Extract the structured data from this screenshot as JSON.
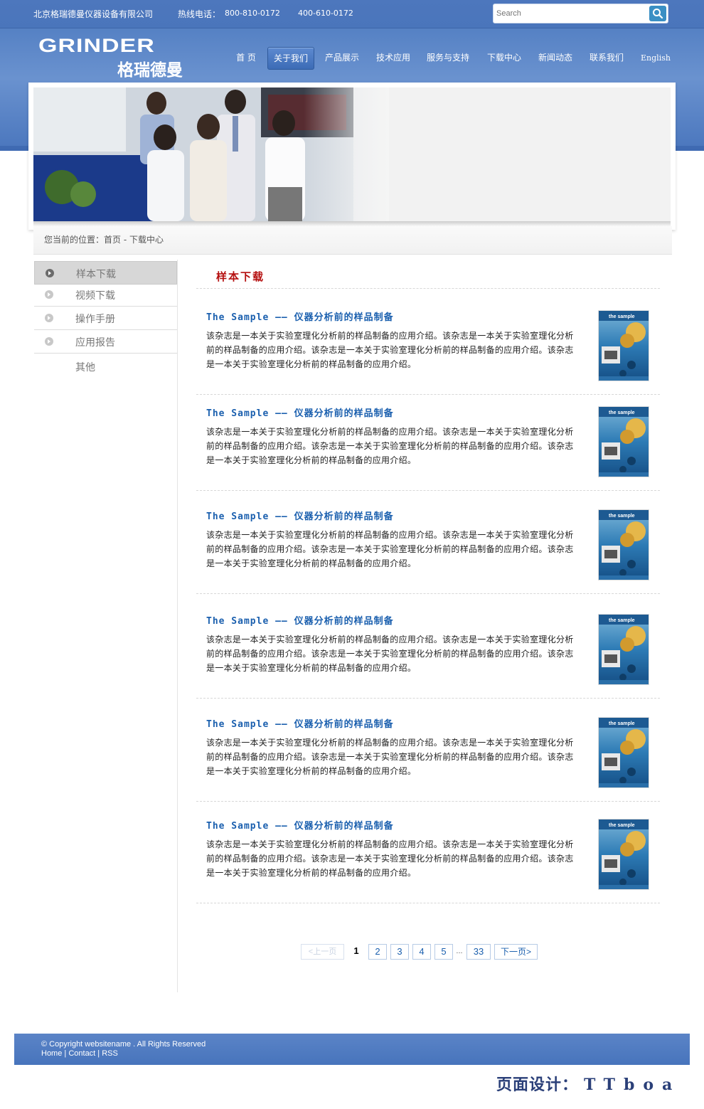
{
  "topbar": {
    "company": "北京格瑞德曼仪器设备有限公司",
    "hotline_label": "热线电话：",
    "phone1": "800-810-0172",
    "phone2": "400-610-0172"
  },
  "search": {
    "placeholder": "Search",
    "icon": "search-icon"
  },
  "logo": {
    "en": "GRINDER",
    "cn": "格瑞德曼"
  },
  "nav": {
    "items": [
      {
        "label": "首 页"
      },
      {
        "label": "关于我们",
        "active": true
      },
      {
        "label": "产品展示"
      },
      {
        "label": "技术应用"
      },
      {
        "label": "服务与支持"
      },
      {
        "label": "下载中心"
      },
      {
        "label": "新闻动态"
      },
      {
        "label": "联系我们"
      },
      {
        "label": "English"
      }
    ]
  },
  "breadcrumb": "您当前的位置：首页 - 下载中心",
  "sidebar": {
    "items": [
      {
        "label": "样本下载",
        "active": true
      },
      {
        "label": "视频下载"
      },
      {
        "label": "操作手册"
      },
      {
        "label": "应用报告"
      },
      {
        "label": "其他"
      }
    ]
  },
  "main": {
    "section_title": "样本下载",
    "items": [
      {
        "title": "The Sample —— 仪器分析前的样品制备",
        "desc": "该杂志是一本关于实验室理化分析前的样品制备的应用介绍。该杂志是一本关于实验室理化分析前的样品制备的应用介绍。该杂志是一本关于实验室理化分析前的样品制备的应用介绍。该杂志是一本关于实验室理化分析前的样品制备的应用介绍。",
        "thumb_text": "the sample"
      },
      {
        "title": "The Sample —— 仪器分析前的样品制备",
        "desc": "该杂志是一本关于实验室理化分析前的样品制备的应用介绍。该杂志是一本关于实验室理化分析前的样品制备的应用介绍。该杂志是一本关于实验室理化分析前的样品制备的应用介绍。该杂志是一本关于实验室理化分析前的样品制备的应用介绍。",
        "thumb_text": "the sample"
      },
      {
        "title": "The Sample —— 仪器分析前的样品制备",
        "desc": "该杂志是一本关于实验室理化分析前的样品制备的应用介绍。该杂志是一本关于实验室理化分析前的样品制备的应用介绍。该杂志是一本关于实验室理化分析前的样品制备的应用介绍。该杂志是一本关于实验室理化分析前的样品制备的应用介绍。",
        "thumb_text": "the sample"
      },
      {
        "title": "The Sample —— 仪器分析前的样品制备",
        "desc": "该杂志是一本关于实验室理化分析前的样品制备的应用介绍。该杂志是一本关于实验室理化分析前的样品制备的应用介绍。该杂志是一本关于实验室理化分析前的样品制备的应用介绍。该杂志是一本关于实验室理化分析前的样品制备的应用介绍。",
        "thumb_text": "the sample"
      },
      {
        "title": "The Sample —— 仪器分析前的样品制备",
        "desc": "该杂志是一本关于实验室理化分析前的样品制备的应用介绍。该杂志是一本关于实验室理化分析前的样品制备的应用介绍。该杂志是一本关于实验室理化分析前的样品制备的应用介绍。该杂志是一本关于实验室理化分析前的样品制备的应用介绍。",
        "thumb_text": "the sample"
      },
      {
        "title": "The Sample —— 仪器分析前的样品制备",
        "desc": "该杂志是一本关于实验室理化分析前的样品制备的应用介绍。该杂志是一本关于实验室理化分析前的样品制备的应用介绍。该杂志是一本关于实验室理化分析前的样品制备的应用介绍。该杂志是一本关于实验室理化分析前的样品制备的应用介绍。",
        "thumb_text": "the sample"
      }
    ]
  },
  "pagination": {
    "prev": "<上一页",
    "current": "1",
    "pages": [
      "2",
      "3",
      "4",
      "5"
    ],
    "ellipsis": "...",
    "last": "33",
    "next": "下一页>"
  },
  "footer": {
    "copyright": "© Copyright websitename . All Rights Reserved",
    "links": [
      "Home",
      "Contact",
      "RSS"
    ]
  },
  "design_credit": {
    "label": "页面设计：",
    "name": "TTboa"
  },
  "colors": {
    "header_blue": "#4a75bb",
    "link_blue": "#1a5fae",
    "title_red": "#b51010"
  }
}
